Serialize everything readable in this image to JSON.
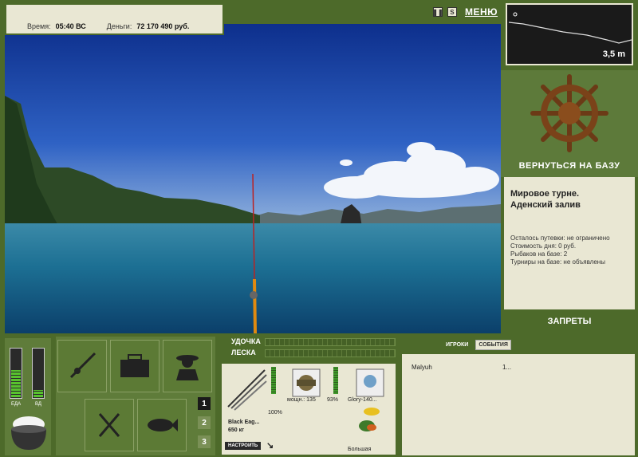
{
  "info": {
    "time_label": "Время:",
    "time_value": "05:40 ВС",
    "money_label": "Деньги:",
    "money_value": "72 170 490 руб."
  },
  "toolbar": {
    "pause_icon": "pause-icon",
    "sound_icon": "sound-icon",
    "menu_label": "МЕНЮ"
  },
  "depth": {
    "value": "3,5 m"
  },
  "base": {
    "return_label": "ВЕРНУТЬСЯ НА БАЗУ",
    "tour_title_1": "Мировое турне.",
    "tour_title_2": "Аденский залив",
    "stat_1": "Осталось путевки: не ограничено",
    "stat_2": "Стоимость дня: 0 руб.",
    "stat_3": "Рыбаков на базе: 2",
    "stat_4": "Турниры на базе: не объявлены",
    "bans_label": "ЗАПРЕТЫ"
  },
  "needs": {
    "food_label": "ЕДА",
    "food_level": 0.55,
    "water_label": "ВД",
    "water_level": 0.15
  },
  "tackle": {
    "rod_label": "УДОЧКА",
    "line_label": "ЛЕСКА",
    "rod_name": "Black Eag...",
    "rod_weight": "650 кг",
    "rod_percent": "100%",
    "setup_label": "НАСТРОИТЬ",
    "reel_power": "мощн.: 135",
    "reel_percent": "93%",
    "bait_name": "Glory-140...",
    "bait_size": "Большая"
  },
  "pages": [
    "1",
    "2",
    "3"
  ],
  "players": {
    "tab_players": "ИГРОКИ",
    "tab_events": "СОБЫТИЯ",
    "rows": [
      {
        "name": "Malyuh",
        "value": "1..."
      }
    ]
  },
  "colors": {
    "panel": "#4d6a2a",
    "cream": "#e9e7d3",
    "bar_green": "#58c22e"
  }
}
